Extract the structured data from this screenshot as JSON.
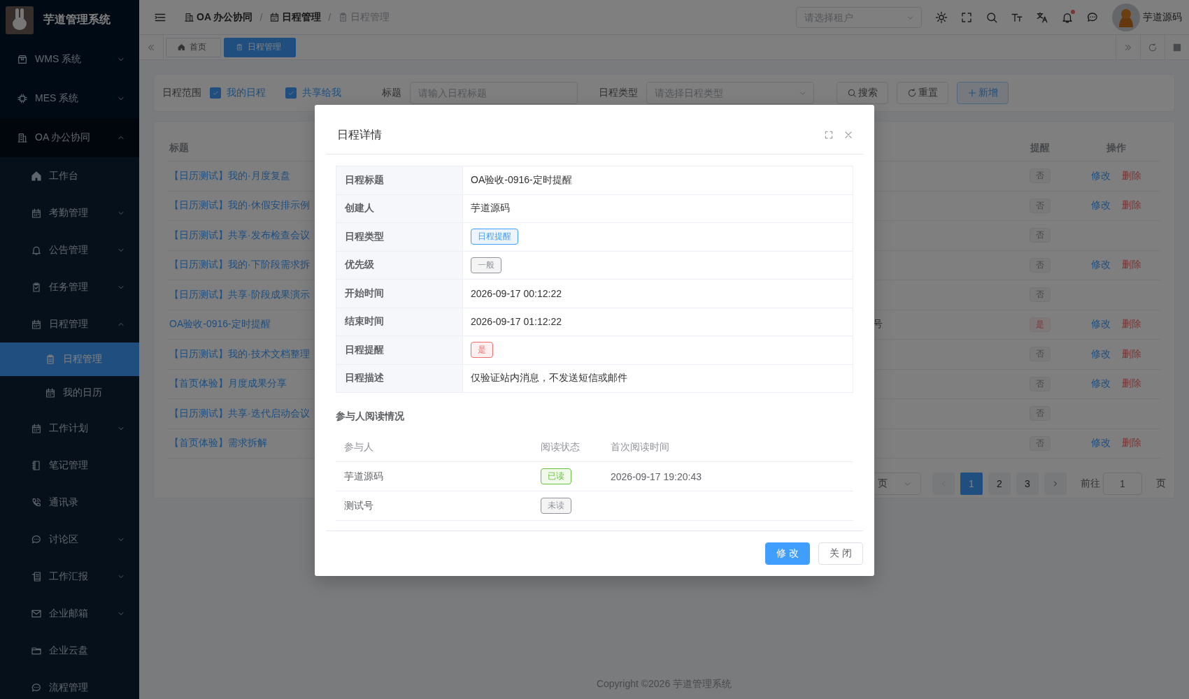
{
  "app_title": "芋道管理系统",
  "sidebar": [
    {
      "label": "WMS 系统",
      "expanded": false
    },
    {
      "label": "MES 系统",
      "expanded": false
    },
    {
      "label": "OA 办公协同",
      "expanded": true,
      "children": [
        {
          "label": "工作台",
          "expandable": false,
          "selected": false
        },
        {
          "label": "考勤管理",
          "expandable": true,
          "expanded": false,
          "selected": false
        },
        {
          "label": "公告管理",
          "expandable": true,
          "expanded": false,
          "selected": false
        },
        {
          "label": "任务管理",
          "expandable": true,
          "expanded": false,
          "selected": false
        },
        {
          "label": "日程管理",
          "expandable": true,
          "expanded": true,
          "selected": false,
          "children": [
            {
              "label": "日程管理",
              "selected": true
            },
            {
              "label": "我的日历",
              "selected": false
            }
          ]
        },
        {
          "label": "工作计划",
          "expandable": true,
          "expanded": false,
          "selected": false
        },
        {
          "label": "笔记管理",
          "expandable": false,
          "selected": false
        },
        {
          "label": "通讯录",
          "expandable": false,
          "selected": false
        },
        {
          "label": "讨论区",
          "expandable": true,
          "expanded": false,
          "selected": false
        },
        {
          "label": "工作汇报",
          "expandable": true,
          "expanded": false,
          "selected": false
        },
        {
          "label": "企业邮箱",
          "expandable": true,
          "expanded": false,
          "selected": false
        },
        {
          "label": "企业云盘",
          "expandable": false,
          "selected": false
        },
        {
          "label": "流程管理",
          "expandable": false,
          "selected": false
        }
      ]
    }
  ],
  "header": {
    "breadcrumbs": [
      {
        "label": "OA 办公协同",
        "current": false
      },
      {
        "separator": "/",
        "label": "日程管理",
        "current": false
      },
      {
        "separator": "/",
        "label": "日程管理",
        "current": true
      }
    ],
    "tenant_placeholder": "请选择租户",
    "notifications_unread": true,
    "user_name": "芋道源码"
  },
  "tags": [
    {
      "label": "首页",
      "selected": false
    },
    {
      "label": "日程管理",
      "selected": true
    }
  ],
  "filter": {
    "range_label": "日程范围",
    "checkboxes": [
      {
        "label": "我的日程",
        "checked": true
      },
      {
        "label": "共享给我",
        "checked": true
      }
    ],
    "title_label": "标题",
    "title_placeholder": "请输入日程标题",
    "type_label": "日程类型",
    "type_placeholder": "请选择日程类型",
    "buttons": [
      {
        "label": "搜索",
        "kind": "search"
      },
      {
        "label": "重置",
        "kind": "reset"
      },
      {
        "label": "新增",
        "kind": "add"
      }
    ]
  },
  "table": {
    "columns": [
      "标题",
      "提醒",
      "操作"
    ],
    "rows": [
      {
        "title": "【日历测试】我的·月度复盘",
        "reminder": "否",
        "reminder_on": false,
        "actions": [
          "修改",
          "删除"
        ]
      },
      {
        "title": "【日历测试】我的·休假安排示例",
        "reminder": "否",
        "reminder_on": false,
        "actions": [
          "修改",
          "删除"
        ]
      },
      {
        "title": "【日历测试】共享·发布检查会议",
        "reminder": "否",
        "reminder_on": false
      },
      {
        "title": "【日历测试】我的·下阶段需求拆",
        "reminder": "否",
        "reminder_on": false,
        "actions": [
          "修改",
          "删除"
        ]
      },
      {
        "title": "【日历测试】共享·阶段成果演示",
        "reminder": "否",
        "reminder_on": false
      },
      {
        "title": "OA验收-0916-定时提醒",
        "column_2": "号",
        "reminder": "是",
        "reminder_on": true,
        "actions": [
          "修改",
          "删除"
        ]
      },
      {
        "title": "【日历测试】我的·技术文档整理",
        "reminder": "否",
        "reminder_on": false,
        "actions": [
          "修改",
          "删除"
        ]
      },
      {
        "title": "【首页体验】月度成果分享",
        "reminder": "否",
        "reminder_on": false,
        "actions": [
          "修改",
          "删除"
        ]
      },
      {
        "title": "【日历测试】共享·迭代启动会议",
        "reminder": "否",
        "reminder_on": false
      },
      {
        "title": "【首页体验】需求拆解",
        "reminder": "否",
        "reminder_on": false,
        "actions": [
          "修改",
          "删除"
        ]
      }
    ]
  },
  "pagination": {
    "size_text": "页",
    "pages": [
      {
        "label": "1",
        "selected": true
      },
      {
        "label": "2",
        "selected": false
      },
      {
        "label": "3",
        "selected": false
      }
    ],
    "goto_label": "前往",
    "goto_value": "1",
    "goto_suffix": "页"
  },
  "dialog": {
    "title": "日程详情",
    "fields": [
      {
        "label": "日程标题",
        "kind": "text",
        "value": "OA验收-0916-定时提醒"
      },
      {
        "label": "创建人",
        "kind": "text",
        "value": "芋道源码"
      },
      {
        "label": "日程类型",
        "kind": "primary",
        "value": "日程提醒"
      },
      {
        "label": "优先级",
        "kind": "info",
        "value": "一般"
      },
      {
        "label": "开始时间",
        "kind": "text",
        "value": "2026-09-17 00:12:22"
      },
      {
        "label": "结束时间",
        "kind": "text",
        "value": "2026-09-17 01:12:22"
      },
      {
        "label": "日程提醒",
        "kind": "danger",
        "value": "是"
      },
      {
        "label": "日程描述",
        "kind": "text",
        "value": "仅验证站内消息，不发送短信或邮件"
      }
    ],
    "section_title": "参与人阅读情况",
    "read_columns": [
      "参与人",
      "阅读状态",
      "首次阅读时间"
    ],
    "read_rows": [
      {
        "name": "芋道源码",
        "status": "已读",
        "read": true,
        "time": "2026-09-17 19:20:43"
      },
      {
        "name": "测试号",
        "status": "未读",
        "read": false
      }
    ],
    "buttons": [
      {
        "label": "修 改",
        "kind": "primary"
      },
      {
        "label": "关 闭",
        "kind": "default"
      }
    ]
  },
  "footer": "Copyright ©2026 芋道管理系统"
}
